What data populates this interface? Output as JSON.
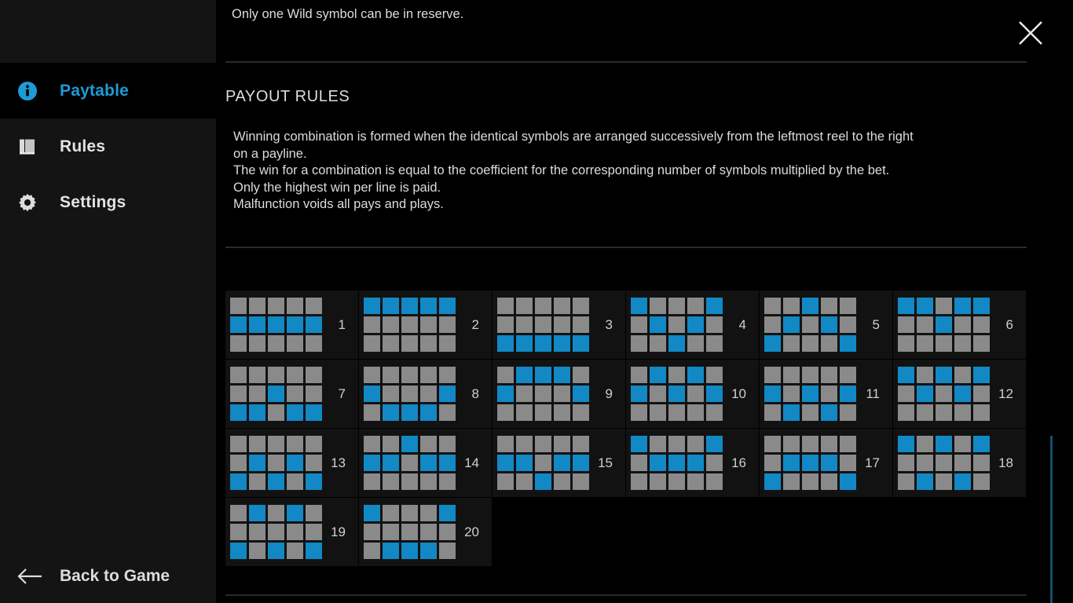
{
  "sidebar": {
    "items": [
      {
        "id": "paytable",
        "label": "Paytable",
        "icon": "info-icon",
        "active": true
      },
      {
        "id": "rules",
        "label": "Rules",
        "icon": "book-icon",
        "active": false
      },
      {
        "id": "settings",
        "label": "Settings",
        "icon": "gear-icon",
        "active": false
      }
    ],
    "back": {
      "label": "Back to Game",
      "icon": "arrow-left-icon"
    }
  },
  "header": {
    "clipped_text": "",
    "reserve_note": "Only one Wild symbol can be in reserve.",
    "close_icon": "close-icon"
  },
  "payout_rules": {
    "title": "PAYOUT RULES",
    "lines": [
      "Winning combination is formed when the identical symbols are arranged successively from the leftmost reel to the right",
      "on a payline.",
      "The win for a combination is equal to the coefficient for the corresponding number of symbols multiplied by the bet.",
      "Only the highest win per line is paid.",
      "Malfunction voids all pays and plays."
    ]
  },
  "colors": {
    "accent_blue": "#1d9bd8",
    "cell_on": "#1288c4",
    "cell_off": "#8a8a8a",
    "panel_bg": "#121212",
    "sidebar_bg": "#141414",
    "scrollbar": "#14516b"
  },
  "paylines": {
    "reels": 5,
    "rows": 3,
    "row_names": [
      "top",
      "middle",
      "bottom"
    ],
    "items": [
      {
        "number": "1",
        "rows": [
          1,
          1,
          1,
          1,
          1
        ]
      },
      {
        "number": "2",
        "rows": [
          0,
          0,
          0,
          0,
          0
        ]
      },
      {
        "number": "3",
        "rows": [
          2,
          2,
          2,
          2,
          2
        ]
      },
      {
        "number": "4",
        "rows": [
          0,
          1,
          2,
          1,
          0
        ]
      },
      {
        "number": "5",
        "rows": [
          2,
          1,
          0,
          1,
          2
        ]
      },
      {
        "number": "6",
        "rows": [
          0,
          0,
          1,
          0,
          0
        ]
      },
      {
        "number": "7",
        "rows": [
          2,
          2,
          1,
          2,
          2
        ]
      },
      {
        "number": "8",
        "rows": [
          1,
          2,
          2,
          2,
          1
        ]
      },
      {
        "number": "9",
        "rows": [
          1,
          0,
          0,
          0,
          1
        ]
      },
      {
        "number": "10",
        "rows": [
          1,
          0,
          1,
          0,
          1
        ]
      },
      {
        "number": "11",
        "rows": [
          1,
          2,
          1,
          2,
          1
        ]
      },
      {
        "number": "12",
        "rows": [
          0,
          1,
          0,
          1,
          0
        ]
      },
      {
        "number": "13",
        "rows": [
          2,
          1,
          2,
          1,
          2
        ]
      },
      {
        "number": "14",
        "rows": [
          1,
          1,
          0,
          1,
          1
        ]
      },
      {
        "number": "15",
        "rows": [
          1,
          1,
          2,
          1,
          1
        ]
      },
      {
        "number": "16",
        "rows": [
          0,
          1,
          1,
          1,
          0
        ]
      },
      {
        "number": "17",
        "rows": [
          2,
          1,
          1,
          1,
          2
        ]
      },
      {
        "number": "18",
        "rows": [
          0,
          2,
          0,
          2,
          0
        ]
      },
      {
        "number": "19",
        "rows": [
          2,
          0,
          2,
          0,
          2
        ]
      },
      {
        "number": "20",
        "rows": [
          0,
          2,
          2,
          2,
          0
        ]
      }
    ]
  }
}
